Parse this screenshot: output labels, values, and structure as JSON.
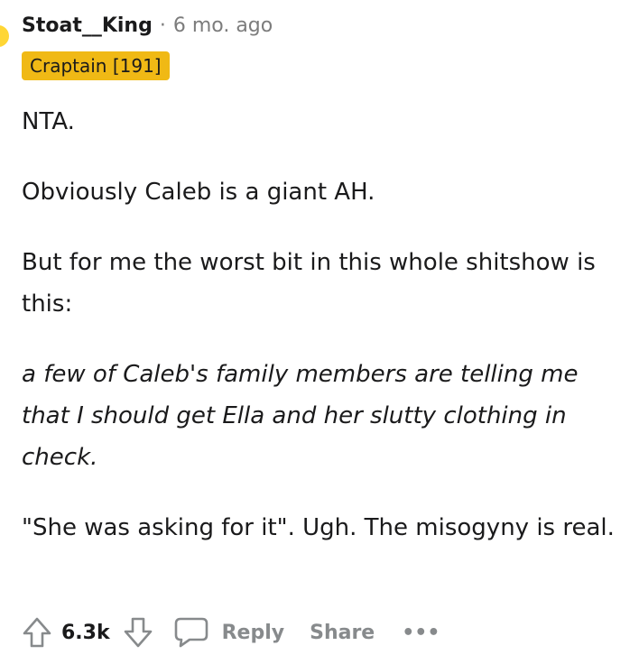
{
  "comment": {
    "username": "Stoat__King",
    "separator": "·",
    "timestamp": "6 mo. ago",
    "flair": "Craptain [191]",
    "paragraphs": [
      "NTA.",
      "Obviously Caleb is a giant AH.",
      "But for me the worst bit in this whole shitshow is this:",
      "a few of Caleb's family members are telling me that I should get Ella and her slutty clothing in check.",
      "\"She was asking for it\". Ugh. The misogyny is real."
    ]
  },
  "actions": {
    "vote_count": "6.3k",
    "reply_label": "Reply",
    "share_label": "Share",
    "more_label": "•••"
  },
  "icons": {
    "upvote": "arrow-up-icon",
    "downvote": "arrow-down-icon",
    "reply": "speech-bubble-icon",
    "more": "more-dots-icon"
  },
  "colors": {
    "flair_background": "#f0b915",
    "avatar": "#ffd635",
    "muted_text": "#7c7c7c",
    "action_text": "#878a8c",
    "body_text": "#1a1a1b"
  }
}
